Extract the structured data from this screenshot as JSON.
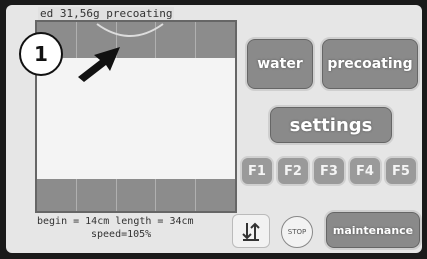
{
  "status": {
    "text": "ed 31,56g precoating"
  },
  "callout": {
    "label": "1"
  },
  "info": {
    "line1": "begin = 14cm length = 34cm",
    "line2": "speed=105%"
  },
  "buttons": {
    "water": "water",
    "precoating": "precoating",
    "settings": "settings",
    "maintenance": "maintenance",
    "stop": "STOP"
  },
  "function_keys": [
    "F1",
    "F2",
    "F3",
    "F4",
    "F5"
  ],
  "work_area": {
    "columns": 5
  },
  "colors": {
    "button_gray": "#8a8a8a",
    "band_gray": "#8c8c8c",
    "screen_bg": "#e6e6e6"
  }
}
